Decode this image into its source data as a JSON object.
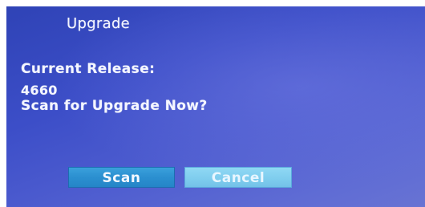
{
  "dialog": {
    "title": "Upgrade",
    "release_label": "Current Release:",
    "release_value": "4660",
    "prompt": "Scan for Upgrade Now?"
  },
  "buttons": {
    "scan": {
      "label": "Scan",
      "state": "focused"
    },
    "cancel": {
      "label": "Cancel",
      "state": "unfocused"
    }
  },
  "colors": {
    "background_top": "#2f43b6",
    "background_bottom": "#6873d3",
    "text": "#f4f6ff",
    "scan_button": "#2b8fd0",
    "cancel_button": "#7fcdee"
  }
}
